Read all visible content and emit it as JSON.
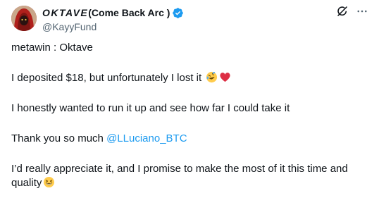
{
  "author": {
    "display_name_styled": "OKTAVE",
    "display_name_rest": "(Come Back Arc )",
    "handle": "@KayyFund",
    "verified": true,
    "verified_color": "#1d9bf0",
    "avatar_icon": "hooded-figure-avatar"
  },
  "actions": {
    "grok_icon": "grok-icon",
    "more_icon": "more-horizontal-icon"
  },
  "tweet": {
    "line1": "metawin : Oktave",
    "line2": "I deposited $18, but unfortunately I lost it",
    "line2_emojis": [
      "rolling-on-floor-laughing-emoji",
      "red-heart-emoji"
    ],
    "line3": "I honestly wanted to run it up and see how far I could take it",
    "line4_prefix": "Thank you so much ",
    "line4_mention": "@LLuciano_BTC",
    "line5": "I’d really appreciate it, and I promise to make the most of it this time and quality",
    "line5_emojis": [
      "grinning-squinting-emoji"
    ]
  },
  "colors": {
    "text": "#0f1419",
    "secondary": "#536471",
    "link": "#1d9bf0"
  }
}
